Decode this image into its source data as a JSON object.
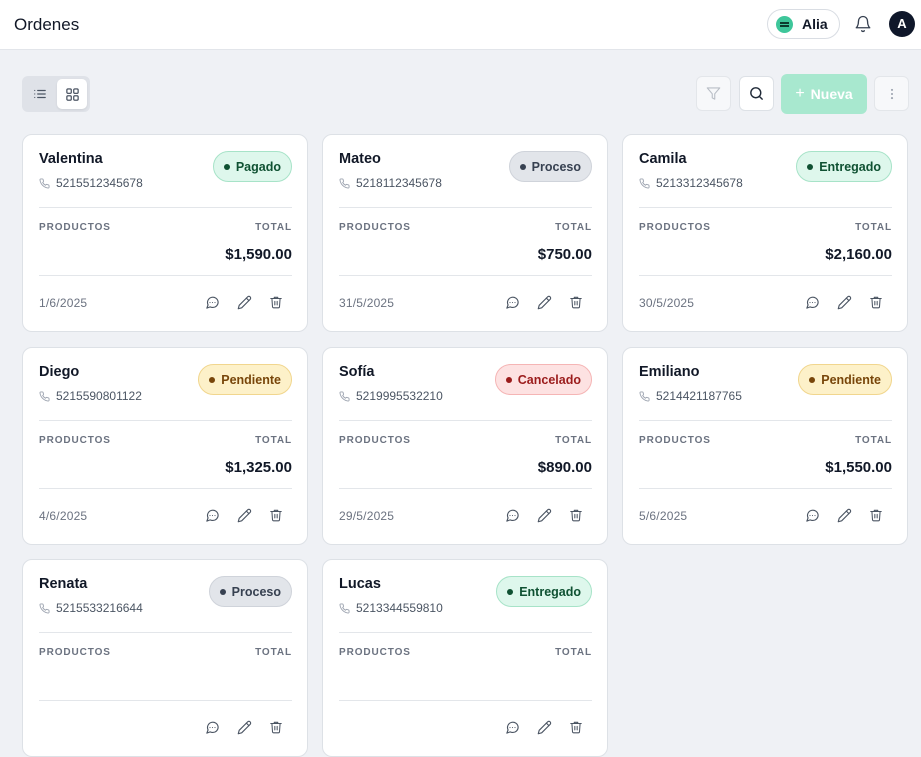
{
  "header": {
    "title": "Ordenes",
    "user_name": "Alia",
    "avatar_initial": "A"
  },
  "toolbar": {
    "new_label": "Nueva",
    "new_plus": "+"
  },
  "status_colors": {
    "Pagado": {
      "bg": "#def7ec",
      "border": "#a7e3c8",
      "text": "#0f5132",
      "dot": "#0f5132"
    },
    "Proceso": {
      "bg": "#e2e5ea",
      "border": "#cfd3da",
      "text": "#374151",
      "dot": "#374151"
    },
    "Entregado": {
      "bg": "#def7ec",
      "border": "#a7e3c8",
      "text": "#0f5132",
      "dot": "#0f5132"
    },
    "Pendiente": {
      "bg": "#fdf1c9",
      "border": "#f1d68e",
      "text": "#78460a",
      "dot": "#78460a"
    },
    "Cancelado": {
      "bg": "#fde2e2",
      "border": "#f5b5b5",
      "text": "#9b1c1c",
      "dot": "#9b1c1c"
    }
  },
  "labels": {
    "products": "PRODUCTOS",
    "total": "TOTAL"
  },
  "orders": [
    {
      "name": "Valentina",
      "phone": "5215512345678",
      "status": "Pagado",
      "total": "$1,590.00",
      "date": "1/6/2025"
    },
    {
      "name": "Mateo",
      "phone": "5218112345678",
      "status": "Proceso",
      "total": "$750.00",
      "date": "31/5/2025"
    },
    {
      "name": "Camila",
      "phone": "5213312345678",
      "status": "Entregado",
      "total": "$2,160.00",
      "date": "30/5/2025"
    },
    {
      "name": "Diego",
      "phone": "5215590801122",
      "status": "Pendiente",
      "total": "$1,325.00",
      "date": "4/6/2025"
    },
    {
      "name": "Sofía",
      "phone": "5219995532210",
      "status": "Cancelado",
      "total": "$890.00",
      "date": "29/5/2025"
    },
    {
      "name": "Emiliano",
      "phone": "5214421187765",
      "status": "Pendiente",
      "total": "$1,550.00",
      "date": "5/6/2025"
    },
    {
      "name": "Renata",
      "phone": "5215533216644",
      "status": "Proceso",
      "total": "",
      "date": ""
    },
    {
      "name": "Lucas",
      "phone": "5213344559810",
      "status": "Entregado",
      "total": "",
      "date": ""
    }
  ]
}
